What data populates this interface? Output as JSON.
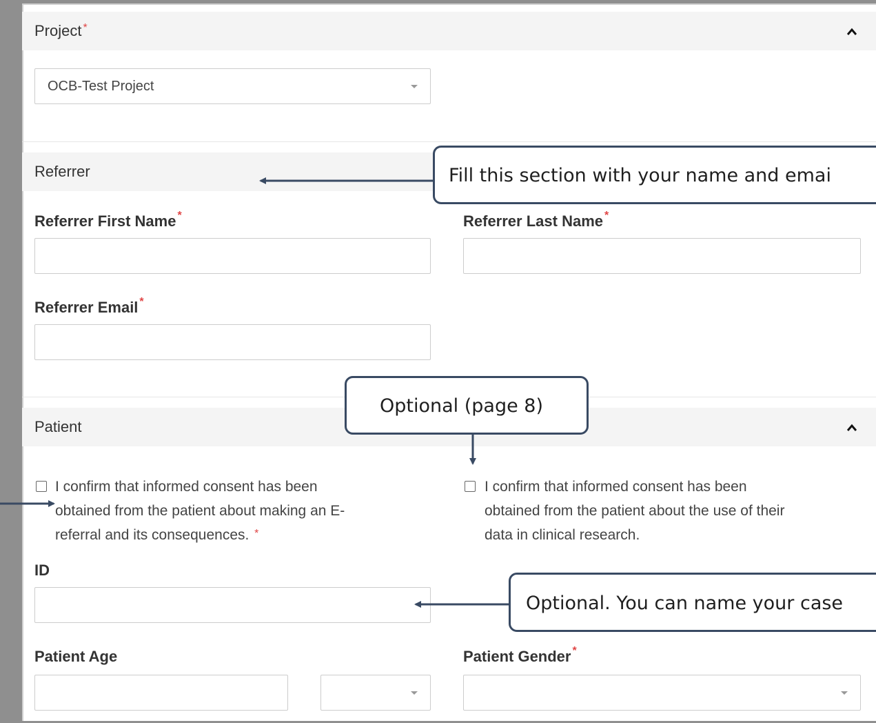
{
  "project": {
    "title": "Project",
    "required_mark": "*",
    "select_value": "OCB-Test Project"
  },
  "referrer": {
    "title": "Referrer",
    "first_name_label": "Referrer First Name",
    "last_name_label": "Referrer Last Name",
    "email_label": "Referrer Email",
    "required_mark": "*"
  },
  "patient": {
    "title": "Patient",
    "consent_referral": "I confirm that informed consent has been obtained from the patient about making an E-referral and its consequences.",
    "consent_referral_lines": [
      "I confirm that informed consent has been",
      "obtained from the patient about making an E-",
      "referral and its consequences."
    ],
    "consent_research_lines": [
      "I confirm that informed consent has been",
      "obtained from the patient about the use of their",
      "data in clinical research."
    ],
    "id_label": "ID",
    "age_label": "Patient Age",
    "gender_label": "Patient Gender",
    "required_mark": "*"
  },
  "callouts": {
    "referrer_note": "Fill this section with your name and emai",
    "optional_page": "Optional (page 8)",
    "id_note": "Optional. You can name your case"
  },
  "colors": {
    "callout_border": "#394a63",
    "required": "#e04545",
    "section_bg": "#f4f4f4"
  }
}
